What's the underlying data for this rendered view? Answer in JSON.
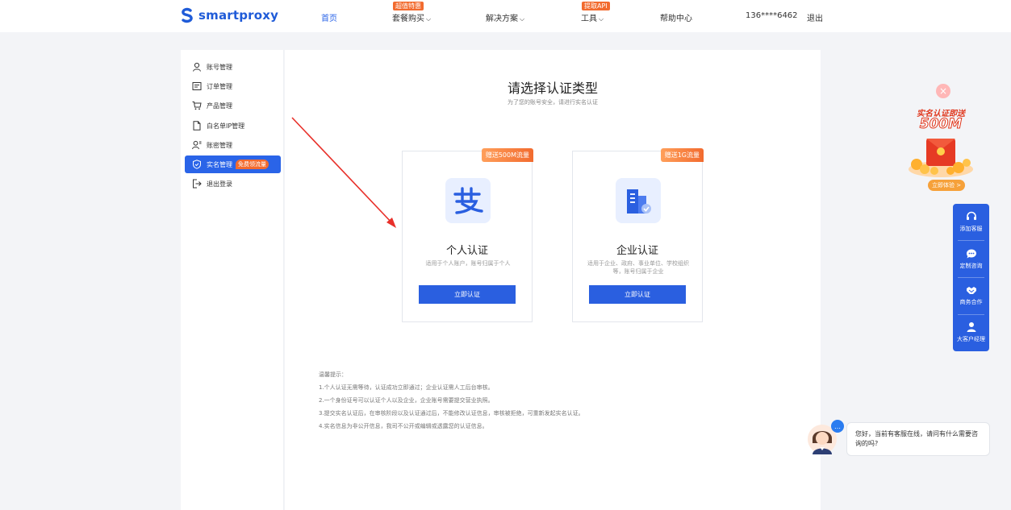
{
  "nav": {
    "brand": "smartproxy",
    "items": [
      {
        "label": "首页",
        "active": true
      },
      {
        "label": "套餐购买",
        "badge": "超值特惠",
        "has_dropdown": true
      },
      {
        "label": "解决方案",
        "has_dropdown": true
      },
      {
        "label": "工具",
        "badge": "提取API",
        "has_dropdown": true
      },
      {
        "label": "帮助中心"
      }
    ],
    "phone": "136****6462",
    "logout": "退出"
  },
  "sidebar": {
    "items": [
      {
        "label": "账号管理",
        "icon": "user-icon"
      },
      {
        "label": "订单管理",
        "icon": "order-icon"
      },
      {
        "label": "产品管理",
        "icon": "cart-icon"
      },
      {
        "label": "白名单IP管理",
        "icon": "document-icon"
      },
      {
        "label": "账密管理",
        "icon": "user-key-icon"
      },
      {
        "label": "实名管理",
        "icon": "shield-icon",
        "active": true,
        "tag": "免费领流量"
      },
      {
        "label": "退出登录",
        "icon": "logout-icon"
      }
    ]
  },
  "main": {
    "title": "请选择认证类型",
    "subtitle": "为了您的账号安全，请进行实名认证",
    "cards": [
      {
        "ribbon": "赠送500M流量",
        "title": "个人认证",
        "desc": "适用于个人账户，账号归属于个人",
        "button": "立即认证",
        "icon": "alipay-icon"
      },
      {
        "ribbon": "赠送1G流量",
        "title": "企业认证",
        "desc": "适用于企业、政府、事业单位、学校组织等，账号归属于企业",
        "button": "立即认证",
        "icon": "building-icon"
      }
    ],
    "tips": [
      "温馨提示：",
      "1.个人认证无需等待，认证成功立即通过；企业认证需人工后台审核。",
      "2.一个身份证号可以认证个人以及企业，企业账号需要提交营业执照。",
      "3.提交实名认证后，在审核阶段以及认证通过后，不能修改认证信息，审核被拒绝，可重新发起实名认证。",
      "4.实名信息为非公开信息，我司不公开或编辑或透露您的认证信息。"
    ]
  },
  "promo": {
    "title": "实名认证即送",
    "amount": "500M",
    "button": "立即体验 >"
  },
  "toolbar": {
    "items": [
      {
        "label": "添加客服",
        "icon": "headset-icon"
      },
      {
        "label": "定制咨询",
        "icon": "chat-icon"
      },
      {
        "label": "商务合作",
        "icon": "handshake-icon"
      },
      {
        "label": "大客户经理",
        "icon": "person-icon"
      }
    ]
  },
  "chat": {
    "message": "您好，当前有客服在线，请问有什么需要咨询的吗?"
  },
  "colors": {
    "primary": "#2a5fe0",
    "accent": "#f26b2f",
    "background": "#f3f4f7"
  }
}
